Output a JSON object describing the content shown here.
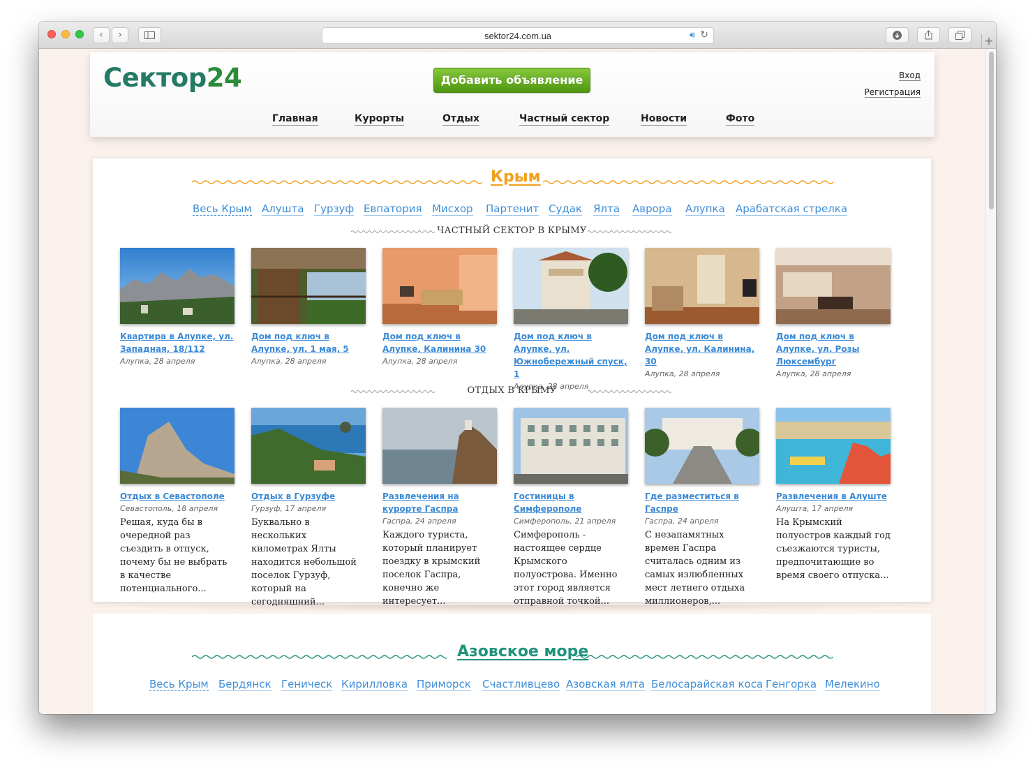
{
  "browser": {
    "url": "sektor24.com.ua",
    "back_icon": "chevron-left",
    "forward_icon": "chevron-right"
  },
  "header": {
    "logo_text": "Сектор",
    "logo_num": "24",
    "add_button": "Добавить объявление",
    "login": "Вход",
    "register": "Регистрация",
    "nav": [
      "Главная",
      "Курорты",
      "Отдых",
      "Частный сектор",
      "Новости",
      "Фото"
    ]
  },
  "crimea": {
    "title": "Крым",
    "title_color": "#f0a01e",
    "cities": [
      "Весь Крым",
      "Алушта",
      "Гурзуф",
      "Евпатория",
      "Мисхор",
      "Партенит",
      "Судак",
      "Ялта",
      "Аврора",
      "Алупка",
      "Арабатская стрелка"
    ],
    "private_heading": "ЧАСТНЫЙ СЕКТОР В КРЫМУ",
    "private_items": [
      {
        "title": "Квартира в Алупке, ул. Западная, 18/112",
        "meta": "Алупка, 28 апреля"
      },
      {
        "title": "Дом под ключ в Алупке, ул. 1 мая, 5",
        "meta": "Алупка, 28 апреля"
      },
      {
        "title": "Дом под ключ в Алупке, Калинина 30",
        "meta": "Алупка, 28 апреля"
      },
      {
        "title": "Дом под ключ в Алупке, ул. Южнобережный спуск, 1",
        "meta": "Алупка, 28 апреля"
      },
      {
        "title": "Дом под ключ в Алупке, ул. Калинина, 30",
        "meta": "Алупка, 28 апреля"
      },
      {
        "title": "Дом под ключ в Алупке, ул. Розы Люксембург",
        "meta": "Алупка, 28 апреля"
      }
    ],
    "rest_heading": "ОТДЫХ В КРЫМУ",
    "rest_items": [
      {
        "title": "Отдых в Севастополе ",
        "meta": "Севастополь, 18 апреля",
        "desc": "Решая, куда бы в очередной раз съездить в отпуск, почему бы не выбрать в качестве потенциального..."
      },
      {
        "title": "Отдых в Гурзуфе",
        "meta": "Гурзуф, 17 апреля",
        "desc": "Буквально в нескольких километрах Ялты находится небольшой поселок Гурзуф, который на сегодняшний..."
      },
      {
        "title": "Развлечения на курорте Гаспра",
        "meta": "Гаспра, 24 апреля",
        "desc": "Каждого туриста, который планирует поездку в крымский поселок Гаспра, конечно же интересует..."
      },
      {
        "title": "Гостиницы в Симферополе",
        "meta": "Симферополь, 21 апреля",
        "desc": "Симферополь - настоящее сердце Крымского полуострова. Именно этот город является отправной точкой..."
      },
      {
        "title": "Где разместиться в Гаспре",
        "meta": "Гаспра, 24 апреля",
        "desc": "С незапамятных времен Гаспра считалась одним из самых излюбленных мест летнего отдыха миллионеров,..."
      },
      {
        "title": "Развлечения в Алуште",
        "meta": "Алушта, 17 апреля",
        "desc": "На Крымский полуостров каждый год съезжаются туристы, предпочитающие во время своего отпуска..."
      }
    ]
  },
  "azov": {
    "title": "Азовское море",
    "title_color": "#21937c",
    "cities": [
      "Весь Крым",
      "Бердянск",
      "Геническ",
      "Кирилловка",
      "Приморск",
      "Счастливцево",
      "Азовская ялта",
      "Белосарайская коса",
      "Генгорка",
      "Мелекино"
    ]
  },
  "colors": {
    "link": "#3f8ed8",
    "logo": "#257a66",
    "button": "#5fa81f"
  }
}
